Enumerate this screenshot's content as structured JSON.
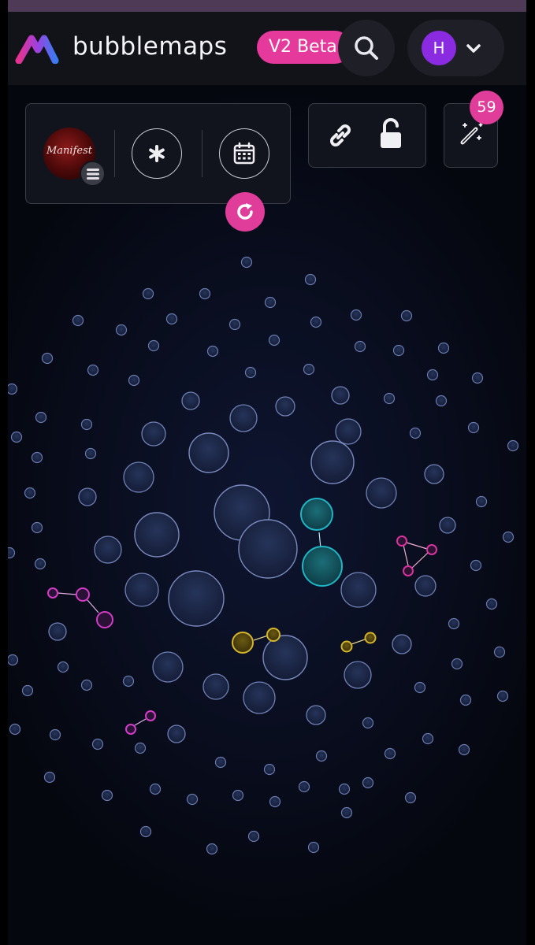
{
  "header": {
    "brand": "bubblemaps",
    "badge": "V2 Beta",
    "user_initial": "H"
  },
  "token": {
    "logo_text": "Manifest"
  },
  "magic": {
    "count": "59"
  },
  "icons": {
    "logo": "bubblemaps-logo-icon",
    "search": "search-icon",
    "chevron": "chevron-down-icon",
    "menu": "menu-icon",
    "asterisk": "asterisk-icon",
    "calendar": "calendar-icon",
    "refresh": "refresh-icon",
    "link": "link-icon",
    "lock": "unlock-icon",
    "magic": "magic-wand-icon"
  },
  "colors": {
    "accent": "#e5399b",
    "bubble_default": "#1e2a4a",
    "cluster_teal": "#1fb5c4",
    "cluster_yellow": "#d4b52a",
    "cluster_magenta": "#d43cc8",
    "cluster_pink": "#d8329f"
  }
}
